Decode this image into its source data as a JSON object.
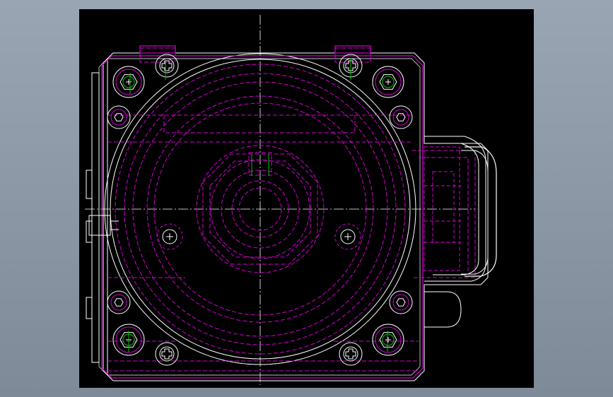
{
  "colors": {
    "background_outer": "#8c97a5",
    "viewport": "#000000",
    "outline": "#ffffff",
    "hidden": "#d400d4",
    "accent": "#00c000"
  },
  "drawing": {
    "view": "top-view",
    "part": "rotary-actuator-body"
  }
}
